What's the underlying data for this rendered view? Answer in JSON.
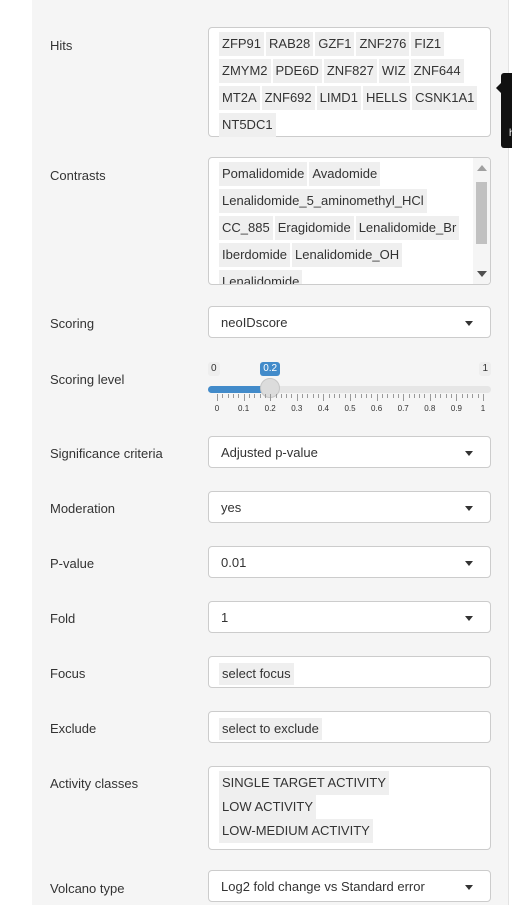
{
  "colors": {
    "accent": "#428bca",
    "panel_bg": "#f5f5f5",
    "chip_bg": "#efefef"
  },
  "hits": {
    "label": "Hits",
    "chips": [
      "ZFP91",
      "RAB28",
      "GZF1",
      "ZNF276",
      "FIZ1",
      "ZMYM2",
      "PDE6D",
      "ZNF827",
      "WIZ",
      "ZNF644",
      "MT2A",
      "ZNF692",
      "LIMD1",
      "HELLS",
      "CSNK1A1",
      "NT5DC1"
    ]
  },
  "contrasts": {
    "label": "Contrasts",
    "chips": [
      "Pomalidomide",
      "Avadomide",
      "Lenalidomide_5_aminomethyl_HCl",
      "CC_885",
      "Eragidomide",
      "Lenalidomide_Br",
      "Iberdomide",
      "Lenalidomide_OH",
      "Lenalidomide"
    ]
  },
  "scoring": {
    "label": "Scoring",
    "value": "neoIDscore"
  },
  "scoring_level": {
    "label": "Scoring level",
    "min": "0",
    "max": "1",
    "current": "0.2",
    "value_fraction": 0.2,
    "ticks": [
      "0",
      "0.1",
      "0.2",
      "0.3",
      "0.4",
      "0.5",
      "0.6",
      "0.7",
      "0.8",
      "0.9",
      "1"
    ]
  },
  "significance": {
    "label": "Significance criteria",
    "value": "Adjusted p-value"
  },
  "moderation": {
    "label": "Moderation",
    "value": "yes"
  },
  "pvalue": {
    "label": "P-value",
    "value": "0.01"
  },
  "fold": {
    "label": "Fold",
    "value": "1"
  },
  "focus": {
    "label": "Focus",
    "placeholder": "select focus"
  },
  "exclude": {
    "label": "Exclude",
    "placeholder": "select to exclude"
  },
  "activity": {
    "label": "Activity classes",
    "chips": [
      "SINGLE TARGET ACTIVITY",
      "LOW ACTIVITY",
      "LOW-MEDIUM ACTIVITY"
    ]
  },
  "volcano": {
    "label": "Volcano type",
    "value": "Log2 fold change vs Standard error"
  },
  "tooltip": {
    "text": "h"
  }
}
